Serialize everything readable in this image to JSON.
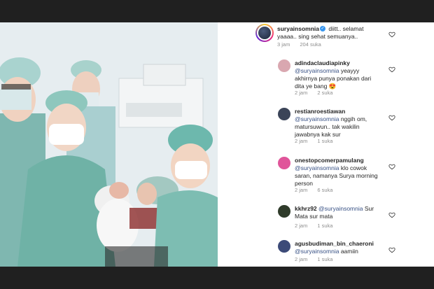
{
  "post": {
    "comment": {
      "username": "suryainsomnia",
      "text": "diitt.. selamat yaaaa.. sing sehat semuanya..",
      "time": "3 jam",
      "likes": "204 suka"
    }
  },
  "replies": [
    {
      "username": "adindaclaudiapinky",
      "mention": "@suryainsomnia",
      "text": "yeayyy akhirnya punya ponakan dari dita ye bang",
      "emoji": "😍",
      "time": "2 jam",
      "likes": "2 suka",
      "avatar_color": "#d9a7b0"
    },
    {
      "username": "restianroestiawan",
      "mention": "@suryainsomnia",
      "text": "nggih om, matursuwun.. tak wakilin jawabnya kak sur",
      "time": "2 jam",
      "likes": "1 suka",
      "avatar_color": "#3b4458"
    },
    {
      "username": "onestopcomerpamulang",
      "mention": "@suryainsomnia",
      "text": "klo cowok saran, namanya Surya morning person",
      "time": "2 jam",
      "likes": "6 suka",
      "avatar_color": "#e0559a"
    },
    {
      "username": "kkhrz92",
      "mention": "@suryainsomnia",
      "text": "Sur Mata sur mata",
      "time": "2 jam",
      "likes": "1 suka",
      "avatar_color": "#2f3b2a"
    },
    {
      "username": "agusbudiman_bin_chaeroni",
      "mention": "@suryainsomnia",
      "text": "aamiin",
      "time": "2 jam",
      "likes": "1 suka",
      "avatar_color": "#3c4a78"
    }
  ],
  "icons": {
    "like": "heart-outline-icon",
    "verified": "verified-badge-icon"
  },
  "colors": {
    "mention": "#385185",
    "meta": "#8e8e8e",
    "verified": "#3897f0",
    "scrub": "#5f9e8e"
  }
}
